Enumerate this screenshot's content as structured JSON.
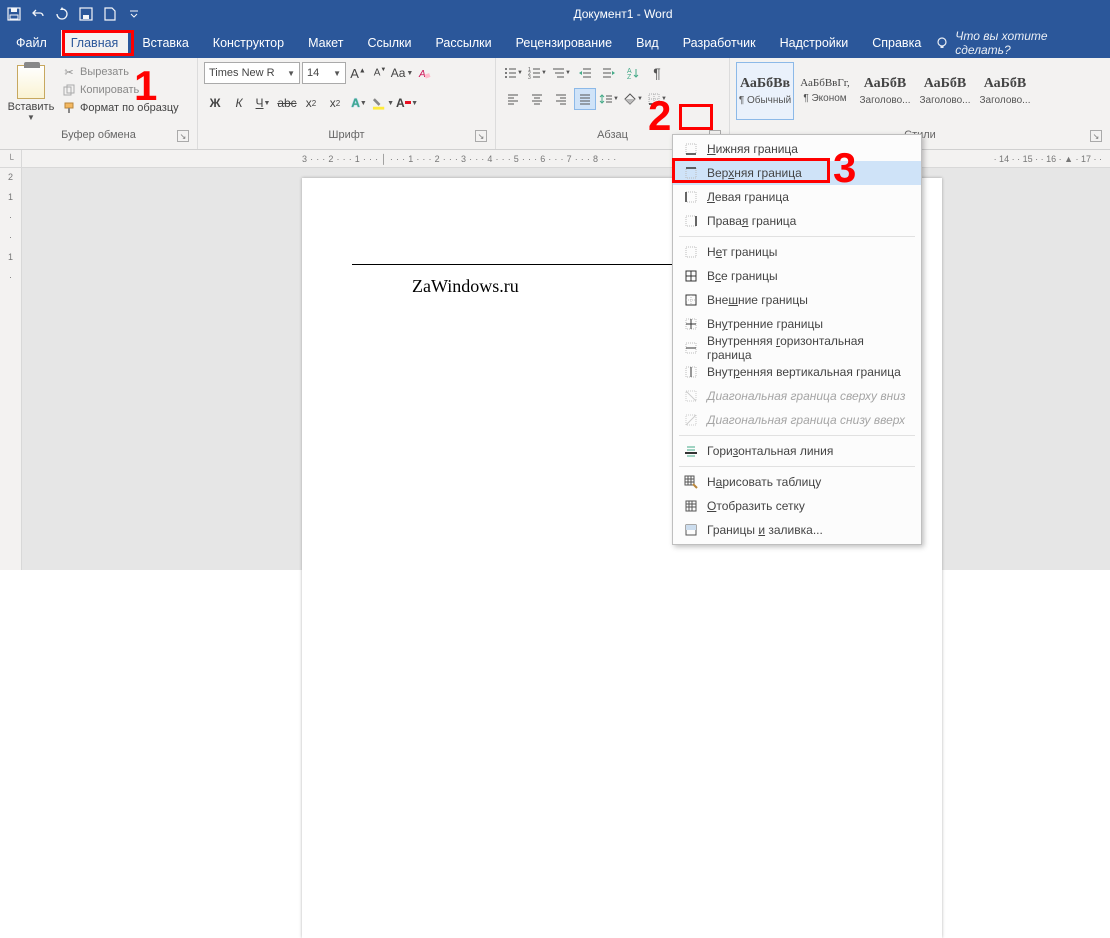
{
  "title": "Документ1  -  Word",
  "tabs": {
    "file": "Файл",
    "home": "Главная",
    "insert": "Вставка",
    "design": "Конструктор",
    "layout": "Макет",
    "references": "Ссылки",
    "mailings": "Рассылки",
    "review": "Рецензирование",
    "view": "Вид",
    "developer": "Разработчик",
    "addins": "Надстройки",
    "help": "Справка",
    "tellme": "Что вы хотите сделать?"
  },
  "clipboard": {
    "paste": "Вставить",
    "cut": "Вырезать",
    "copy": "Копировать",
    "format_painter": "Формат по образцу",
    "label": "Буфер обмена"
  },
  "font": {
    "name": "Times New R",
    "size": "14",
    "label": "Шрифт",
    "bold": "Ж",
    "italic": "К",
    "underline": "Ч",
    "strike": "abc",
    "sub": "x",
    "sup": "x"
  },
  "para": {
    "label": "Абзац"
  },
  "styles": {
    "label": "Стили",
    "items": [
      {
        "preview": "АаБбВв",
        "name": "¶ Обычный"
      },
      {
        "preview": "АаБбВвГг,",
        "name": "¶ Эконом"
      },
      {
        "preview": "АаБбВ",
        "name": "Заголово..."
      },
      {
        "preview": "АаБбВ",
        "name": "Заголово..."
      },
      {
        "preview": "АаБбВ",
        "name": "Заголово..."
      }
    ]
  },
  "ruler": {
    "main": "3 · · · 2 · · · 1 · · · │ · · · 1 · · · 2 · · · 3 · · · 4 · · · 5 · · · 6 · · · 7 · · · 8 · · ·",
    "right": "· 14 · · 15 · · 16 · ▲ · 17 · ·",
    "v": "2\n\n1\n\n·\n\n·\n\n1\n\n·"
  },
  "doc": {
    "text": "ZaWindows.ru"
  },
  "menu": {
    "bottom": "Нижняя граница",
    "top": "Верхняя граница",
    "left": "Левая граница",
    "right": "Правая граница",
    "none": "Нет границы",
    "all": "Все границы",
    "outer": "Внешние границы",
    "inner": "Внутренние границы",
    "inner_h": "Внутренняя горизонтальная граница",
    "inner_v": "Внутренняя вертикальная граница",
    "diag_down": "Диагональная граница сверху вниз",
    "diag_up": "Диагональная граница снизу вверх",
    "hline": "Горизонтальная линия",
    "draw": "Нарисовать таблицу",
    "grid": "Отобразить сетку",
    "dlg": "Границы и заливка..."
  },
  "ann": {
    "n1": "1",
    "n2": "2",
    "n3": "3"
  }
}
